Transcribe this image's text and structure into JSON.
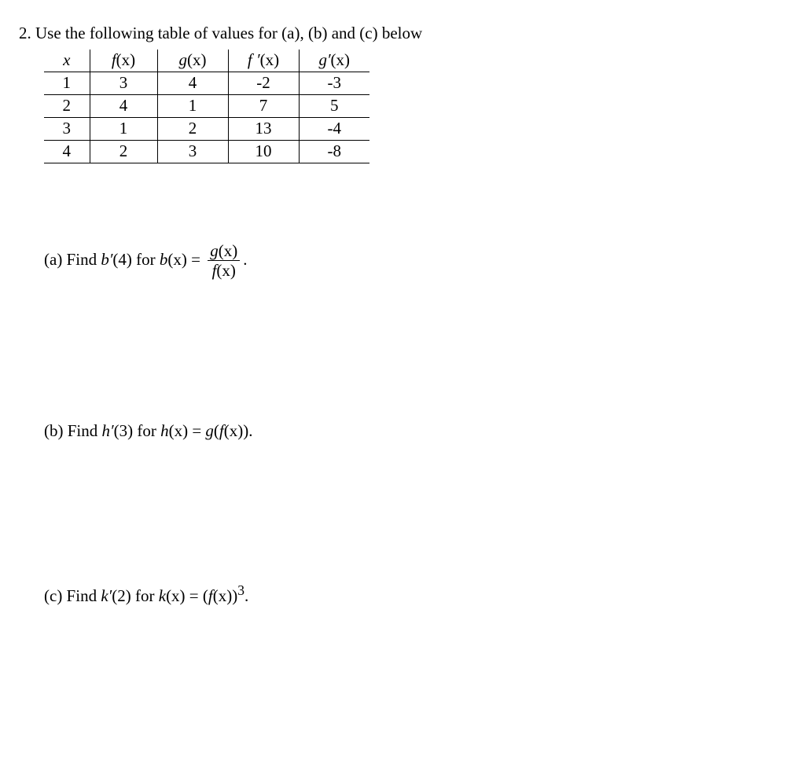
{
  "intro": "2. Use the following table of values for (a), (b) and (c) below",
  "table": {
    "headers": {
      "x": "x",
      "fx_f": "f",
      "fx_x": "(x)",
      "gx_g": "g",
      "gx_x": "(x)",
      "fpx_f": "f ′",
      "fpx_x": "(x)",
      "gpx_g": "g′",
      "gpx_x": "(x)"
    },
    "rows": [
      {
        "x": "1",
        "fx": "3",
        "gx": "4",
        "fpx": "-2",
        "gpx": "-3"
      },
      {
        "x": "2",
        "fx": "4",
        "gx": "1",
        "fpx": "7",
        "gpx": "5"
      },
      {
        "x": "3",
        "fx": "1",
        "gx": "2",
        "fpx": "13",
        "gpx": "-4"
      },
      {
        "x": "4",
        "fx": "2",
        "gx": "3",
        "fpx": "10",
        "gpx": "-8"
      }
    ]
  },
  "parts": {
    "a": {
      "prefix": "(a) Find ",
      "bprime": "b′",
      "arg4": "(4) for ",
      "bfn": "b",
      "bargx": "(x) = ",
      "frac_num_g": "g",
      "frac_num_x": "(x)",
      "frac_den_f": "f",
      "frac_den_x": "(x)",
      "period": "."
    },
    "b": {
      "prefix": "(b) Find ",
      "hprime": "h′",
      "arg3": "(3) for ",
      "hfn": "h",
      "hargx": "(x) = ",
      "gfn": "g",
      "open": "(",
      "ffn": "f",
      "farg": "(x)).",
      "period": ""
    },
    "c": {
      "prefix": "(c) Find ",
      "kprime": "k′",
      "arg2": "(2) for ",
      "kfn": "k",
      "kargx": "(x) = (",
      "ffn": "f",
      "farg": "(x))",
      "exp": "3",
      "period": "."
    }
  }
}
